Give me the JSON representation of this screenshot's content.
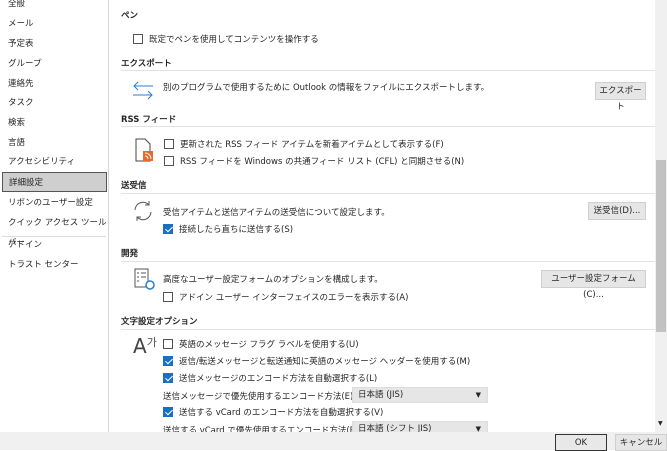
{
  "sidebar": {
    "items": [
      "全般",
      "メール",
      "予定表",
      "グループ",
      "連絡先",
      "タスク",
      "検索",
      "言語",
      "アクセシビリティ",
      "詳細設定",
      "リボンのユーザー設定",
      "クイック アクセス ツール バー",
      "アドイン",
      "トラスト センター"
    ],
    "selected": "詳細設定"
  },
  "pen": {
    "heading": "ペン",
    "option": "既定でペンを使用してコンテンツを操作する"
  },
  "export": {
    "heading": "エクスポート",
    "description": "別のプログラムで使用するために Outlook の情報をファイルにエクスポートします。",
    "button": "エクスポート"
  },
  "rss": {
    "heading": "RSS フィード",
    "option1": "更新された RSS フィード アイテムを新着アイテムとして表示する(F)",
    "option2": "RSS フィードを Windows の共通フィード リスト (CFL) と同期させる(N)"
  },
  "sendrecv": {
    "heading": "送受信",
    "description": "受信アイテムと送信アイテムの送受信について設定します。",
    "button": "送受信(D)...",
    "option": "接続したら直ちに送信する(S)"
  },
  "dev": {
    "heading": "開発",
    "description": "高度なユーザー設定フォームのオプションを構成します。",
    "button": "ユーザー設定フォーム(C)...",
    "option": "アドイン ユーザー インターフェイスのエラーを表示する(A)"
  },
  "intl": {
    "heading": "文字設定オプション",
    "option1": "英語のメッセージ フラグ ラベルを使用する(U)",
    "option2": "返信/転送メッセージと転送通知に英語のメッセージ ヘッダーを使用する(M)",
    "option3": "送信メッセージのエンコード方法を自動選択する(L)",
    "encoding_label": "送信メッセージで優先使用するエンコード方法(E):",
    "encoding_value": "日本語 (JIS)",
    "option4": "送信する vCard のエンコード方法を自動選択する(V)",
    "vcard_label": "送信する vCard で優先使用するエンコード方法(R):",
    "vcard_value": "日本語 (シフト JIS)"
  },
  "footer": {
    "ok": "OK",
    "cancel": "キャンセル"
  },
  "colors": {
    "accent": "#1a6fc4",
    "rss": "#e8692c"
  }
}
